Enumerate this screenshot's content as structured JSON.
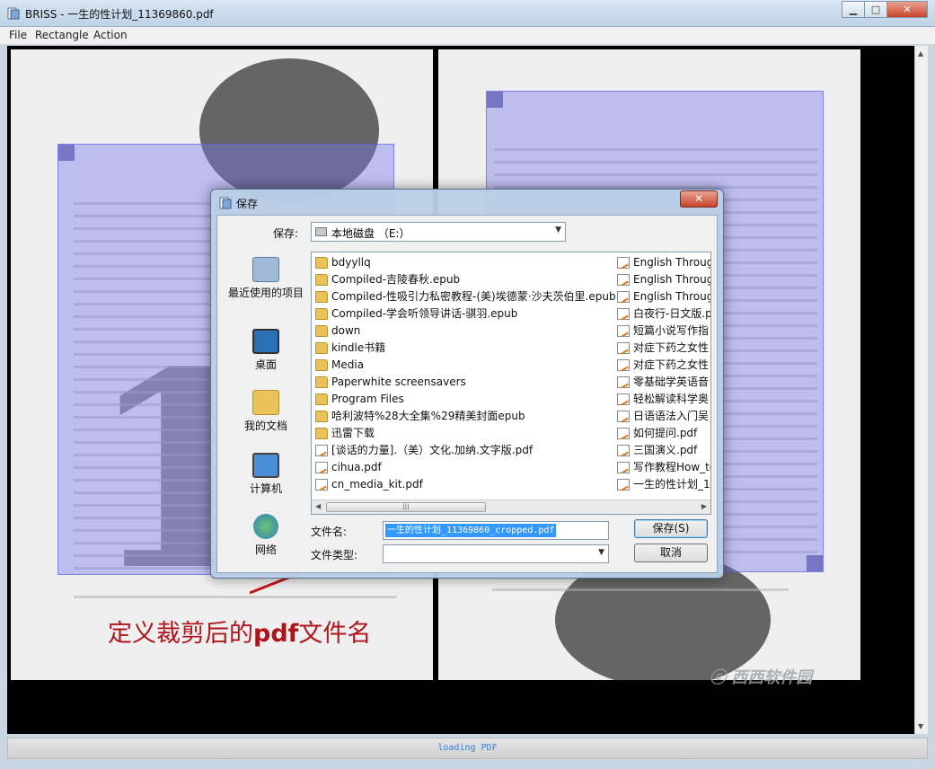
{
  "window": {
    "title": "BRISS - 一生的性计划_11369860.pdf"
  },
  "menu": [
    "File",
    "Rectangle",
    "Action"
  ],
  "status": {
    "text": "loading PDF"
  },
  "annotation": {
    "text_pre": "定义裁剪后的",
    "text_bold": "pdf",
    "text_post": "文件名"
  },
  "watermark": {
    "text": "ⓒ 西西软件园"
  },
  "save_dialog": {
    "title": "保存",
    "save_in_label": "保存:",
    "location": "本地磁盘 （E:）",
    "places": [
      {
        "label": "最近使用的项目",
        "icon": "recent-places-icon"
      },
      {
        "label": "桌面",
        "icon": "desktop-icon"
      },
      {
        "label": "我的文档",
        "icon": "my-documents-icon"
      },
      {
        "label": "计算机",
        "icon": "computer-icon"
      },
      {
        "label": "网络",
        "icon": "network-icon"
      }
    ],
    "files_col1": [
      {
        "name": "bdyyllq",
        "type": "folder"
      },
      {
        "name": "Compiled-吉陵春秋.epub",
        "type": "folder"
      },
      {
        "name": "Compiled-性吸引力私密教程-(美)埃德蒙·沙夫茨伯里.epub",
        "type": "folder"
      },
      {
        "name": "Compiled-学会听领导讲话-骐羽.epub",
        "type": "folder"
      },
      {
        "name": "down",
        "type": "folder"
      },
      {
        "name": "kindle书籍",
        "type": "folder"
      },
      {
        "name": "Media",
        "type": "folder"
      },
      {
        "name": "Paperwhite screensavers",
        "type": "folder"
      },
      {
        "name": "Program Files",
        "type": "folder"
      },
      {
        "name": "哈利波特%28大全集%29精美封面epub",
        "type": "folder"
      },
      {
        "name": "迅雷下载",
        "type": "folder"
      },
      {
        "name": "[谈话的力量].（美）文化.加纳.文字版.pdf",
        "type": "pdf"
      },
      {
        "name": "cihua.pdf",
        "type": "pdf"
      },
      {
        "name": "cn_media_kit.pdf",
        "type": "pdf"
      }
    ],
    "files_col2": [
      {
        "name": "English Throug",
        "type": "pdf"
      },
      {
        "name": "English Throug",
        "type": "pdf"
      },
      {
        "name": "English Throug",
        "type": "pdf"
      },
      {
        "name": "白夜行-日文版.p",
        "type": "pdf"
      },
      {
        "name": "短篇小说写作指",
        "type": "pdf"
      },
      {
        "name": "对症下药之女性",
        "type": "pdf"
      },
      {
        "name": "对症下药之女性",
        "type": "pdf"
      },
      {
        "name": "零基础学英语音",
        "type": "pdf"
      },
      {
        "name": "轻松解读科学奥",
        "type": "pdf"
      },
      {
        "name": "日语语法入门吴",
        "type": "pdf"
      },
      {
        "name": "如何提问.pdf",
        "type": "pdf"
      },
      {
        "name": "三国演义.pdf",
        "type": "pdf"
      },
      {
        "name": "写作教程How_to",
        "type": "pdf"
      },
      {
        "name": "一生的性计划_1",
        "type": "pdf"
      }
    ],
    "filename_label": "文件名:",
    "filename_value": "一生的性计划_11369860_cropped.pdf",
    "filetype_label": "文件类型:",
    "filetype_value": "",
    "save_button": "保存(S)",
    "cancel_button": "取消"
  }
}
